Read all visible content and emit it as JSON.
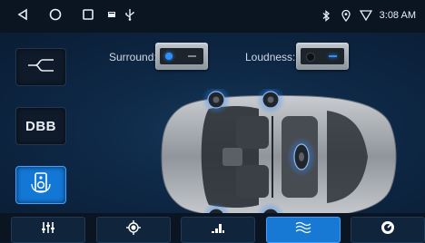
{
  "status": {
    "icons_left": [
      "back-icon",
      "home-icon",
      "recents-icon",
      "notification-icon",
      "usb-icon"
    ],
    "icons_right": [
      "bluetooth-icon",
      "location-icon",
      "wifi-icon"
    ],
    "time": "3:08 AM"
  },
  "side": {
    "items": [
      {
        "name": "eq-curve-button",
        "icon": "eq-curve-icon"
      },
      {
        "name": "dbb-button",
        "label": "DBB"
      },
      {
        "name": "speaker-button",
        "icon": "speaker-icon",
        "active": true
      }
    ]
  },
  "controls": {
    "surround_label": "Surround:",
    "surround_on": true,
    "loudness_label": "Loudness:",
    "loudness_on": false
  },
  "nav": {
    "items": [
      {
        "name": "sliders-tab",
        "icon": "sliders-icon"
      },
      {
        "name": "balance-tab",
        "icon": "target-icon"
      },
      {
        "name": "equalizer-tab",
        "icon": "equalizer-icon"
      },
      {
        "name": "sound-field-tab",
        "icon": "wave-icon",
        "active": true
      },
      {
        "name": "preset-tab",
        "icon": "gauge-icon"
      }
    ]
  },
  "colors": {
    "accent": "#1879d5",
    "background": "#0a1a2c",
    "speaker_glow": "#2f8cff"
  }
}
